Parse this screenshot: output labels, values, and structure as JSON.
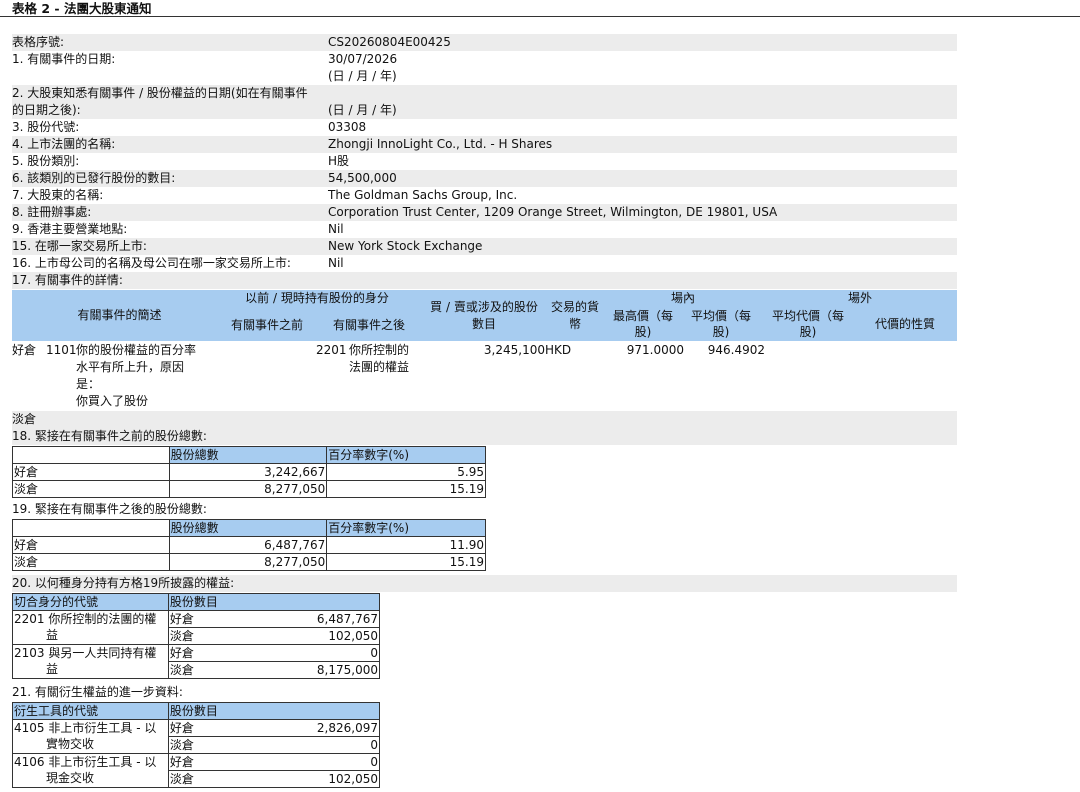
{
  "title": "表格 2 - 法團大股東通知",
  "fields": [
    {
      "label": "表格序號:",
      "value": "CS20260804E00425"
    },
    {
      "label": "1. 有關事件的日期:",
      "value": "30/07/2026",
      "value2": "(日 / 月 / 年)"
    },
    {
      "label": "2. 大股東知悉有關事件 / 股份權益的日期(如在有關事件",
      "label2": "的日期之後):",
      "value": "(日 / 月 / 年)"
    },
    {
      "label": "3. 股份代號:",
      "value": "03308"
    },
    {
      "label": "4. 上市法團的名稱:",
      "value": "Zhongji InnoLight Co., Ltd. - H Shares"
    },
    {
      "label": "5. 股份類別:",
      "value": "H股"
    },
    {
      "label": "6. 該類別的已發行股份的數目:",
      "value": "54,500,000"
    },
    {
      "label": "7. 大股東的名稱:",
      "value": "The Goldman Sachs Group, Inc."
    },
    {
      "label": "8. 註冊辦事處:",
      "value": "Corporation Trust Center, 1209 Orange Street, Wilmington, DE 19801, USA"
    },
    {
      "label": "9. 香港主要營業地點:",
      "value": "Nil"
    },
    {
      "label": "15. 在哪一家交易所上市:",
      "value": "New York Stock Exchange"
    },
    {
      "label": "16. 上市母公司的名稱及母公司在哪一家交易所上市:",
      "value": "Nil"
    }
  ],
  "sec17": {
    "title": "17. 有關事件的詳情:",
    "headers": {
      "desc": "有關事件的簡述",
      "capacity": "以前 / 現時持有股份的身分",
      "before": "有關事件之前",
      "after": "有關事件之後",
      "shares": [
        "買 / 賣或涉及的股份",
        "數目"
      ],
      "currency": [
        "交易的貨",
        "幣"
      ],
      "onex": "場內",
      "highest": [
        "最高價（每",
        "股)"
      ],
      "average": [
        "平均價（每",
        "股)"
      ],
      "offex": "場外",
      "avgcons": [
        "平均代價（每",
        "股)"
      ],
      "nature": "代價的性質"
    },
    "row": {
      "position": "好倉",
      "code": "1101",
      "desc": [
        "你的股份權益的百分率",
        "水平有所上升，原因",
        "是：",
        "你買入了股份"
      ],
      "after_code": "2201",
      "after": [
        "你所控制的",
        "法團的權益"
      ],
      "shares": "3,245,100",
      "currency": "HKD",
      "highest": "971.0000",
      "average": "946.4902"
    },
    "short_label": "淡倉"
  },
  "sec18": {
    "title": "18. 緊接在有關事件之前的股份總數:",
    "col1": "股份總數",
    "col2": "百分率數字(%)",
    "rows": [
      {
        "label": "好倉",
        "total": "3,242,667",
        "pct": "5.95"
      },
      {
        "label": "淡倉",
        "total": "8,277,050",
        "pct": "15.19"
      }
    ]
  },
  "sec19": {
    "title": "19. 緊接在有關事件之後的股份總數:",
    "col1": "股份總數",
    "col2": "百分率數字(%)",
    "rows": [
      {
        "label": "好倉",
        "total": "6,487,767",
        "pct": "11.90"
      },
      {
        "label": "淡倉",
        "total": "8,277,050",
        "pct": "15.19"
      }
    ]
  },
  "sec20": {
    "title": "20. 以何種身分持有方格19所披露的權益:",
    "col1": "切合身分的代號",
    "col2": "股份數目",
    "groups": [
      {
        "code": "2201",
        "name1": "你所控制的法團的權",
        "name2": "益",
        "long_label": "好倉",
        "long": "6,487,767",
        "short_label": "淡倉",
        "short": "102,050"
      },
      {
        "code": "2103",
        "name1": "與另一人共同持有權",
        "name2": "益",
        "long_label": "好倉",
        "long": "0",
        "short_label": "淡倉",
        "short": "8,175,000"
      }
    ]
  },
  "sec21": {
    "title": "21. 有關衍生權益的進一步資料:",
    "col1": "衍生工具的代號",
    "col2": "股份數目",
    "groups": [
      {
        "code": "4105",
        "name1": "非上市衍生工具 - 以",
        "name2": "實物交收",
        "long_label": "好倉",
        "long": "2,826,097",
        "short_label": "淡倉",
        "short": "0"
      },
      {
        "code": "4106",
        "name1": "非上市衍生工具 - 以",
        "name2": "現金交收",
        "long_label": "好倉",
        "long": "0",
        "short_label": "淡倉",
        "short": "102,050"
      }
    ]
  }
}
